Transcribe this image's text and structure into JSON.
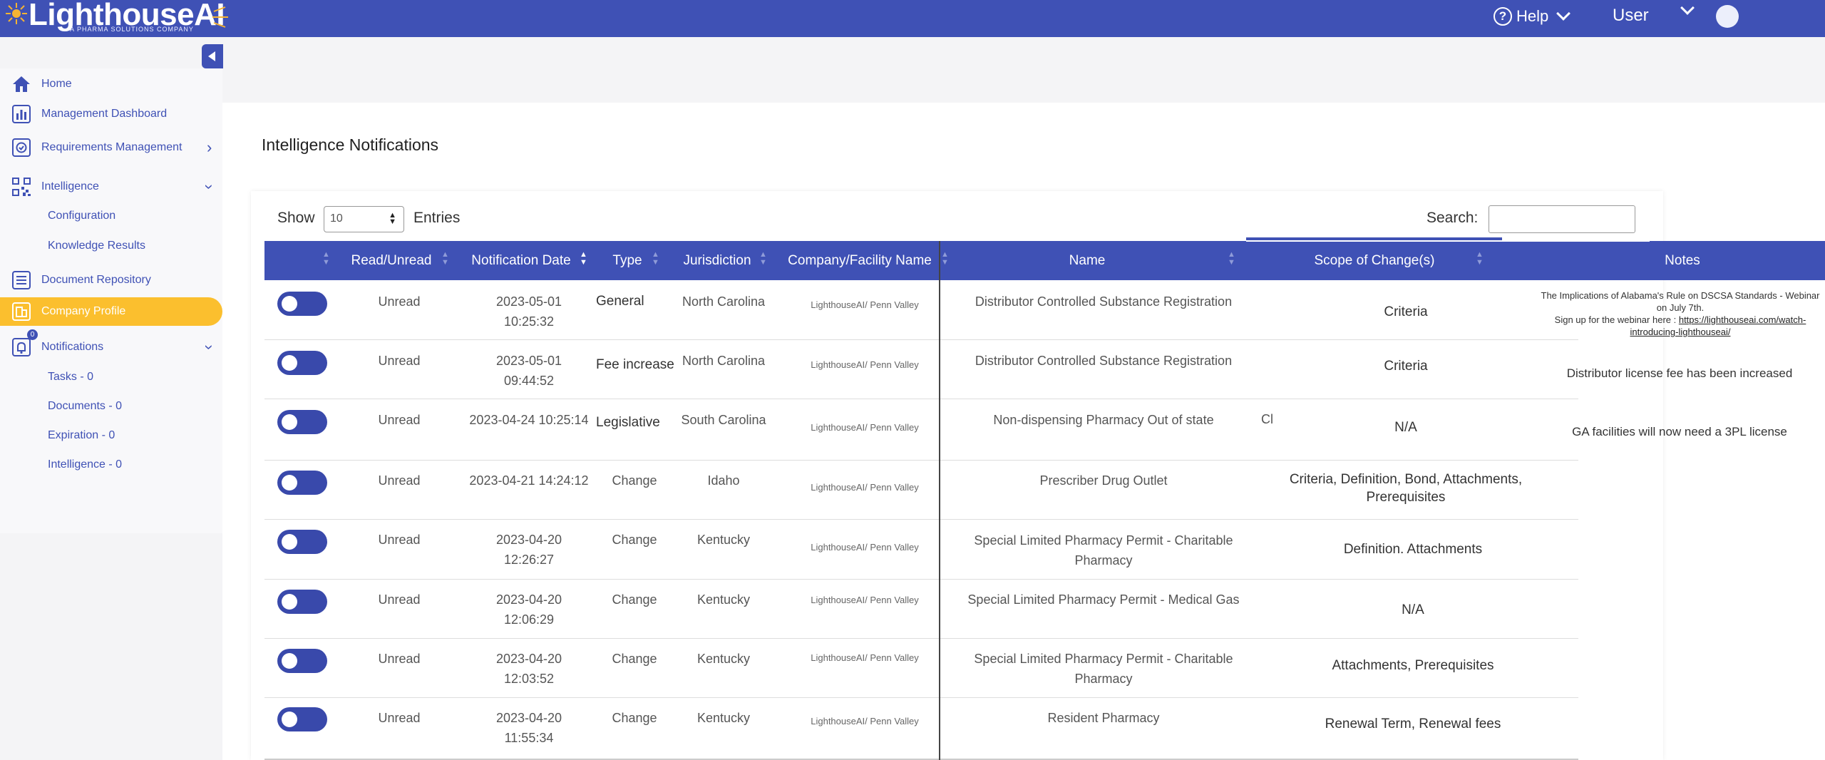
{
  "header": {
    "logo_text": "LighthouseAI",
    "logo_tagline": "A PHARMA SOLUTIONS COMPANY",
    "help_label": "Help",
    "user_label": "User"
  },
  "sidebar": {
    "items": [
      {
        "label": "Home",
        "icon": "home-icon"
      },
      {
        "label": "Management Dashboard",
        "icon": "bar-chart-icon"
      },
      {
        "label": "Requirements Management",
        "icon": "check-circle-icon"
      },
      {
        "label": "Intelligence",
        "icon": "qr-grid-icon"
      },
      {
        "label": "Configuration"
      },
      {
        "label": "Knowledge Results"
      },
      {
        "label": "Document Repository",
        "icon": "document-list-icon"
      },
      {
        "label": "Company Profile",
        "icon": "building-icon"
      },
      {
        "label": "Notifications",
        "icon": "bell-icon",
        "badge": "0"
      },
      {
        "label": "Tasks - 0"
      },
      {
        "label": "Documents - 0"
      },
      {
        "label": "Expiration - 0"
      },
      {
        "label": "Intelligence - 0"
      }
    ]
  },
  "page": {
    "title": "Intelligence Notifications",
    "show_label": "Show",
    "entries_value": "10",
    "entries_label": "Entries",
    "search_label": "Search:"
  },
  "table": {
    "columns": [
      "Read/Unread",
      "Notification Date",
      "Type",
      "Jurisdiction",
      "Company/Facility Name",
      "Name",
      "Scope of Change(s)",
      "Notes"
    ],
    "rows": [
      {
        "status": "Unread",
        "date": "2023-05-01",
        "time": "10:25:32",
        "type": "General",
        "jurisdiction": "North Carolina",
        "company": "LighthouseAI/ Penn Valley",
        "name": "Distributor Controlled Substance Registration",
        "scope": "Criteria"
      },
      {
        "status": "Unread",
        "date": "2023-05-01",
        "time": "09:44:52",
        "type": "Fee increase",
        "jurisdiction": "North Carolina",
        "company": "LighthouseAI/ Penn Valley",
        "name": "Distributor Controlled Substance Registration",
        "scope": "Criteria"
      },
      {
        "status": "Unread",
        "date": "2023-04-24 10:25:14",
        "time": "",
        "type": "Legislative",
        "jurisdiction": "South Carolina",
        "company": "LighthouseAI/ Penn Valley",
        "name": "Non-dispensing Pharmacy Out of state",
        "scope": "N/A"
      },
      {
        "status": "Unread",
        "date": "2023-04-21 14:24:12",
        "time": "",
        "type": "Change",
        "jurisdiction": "Idaho",
        "company": "LighthouseAI/ Penn Valley",
        "name": "Prescriber Drug Outlet",
        "scope": "Criteria, Definition, Bond, Attachments,",
        "scope2": "Prerequisites"
      },
      {
        "status": "Unread",
        "date": "2023-04-20",
        "time": "12:26:27",
        "type": "Change",
        "jurisdiction": "Kentucky",
        "company": "LighthouseAI/ Penn Valley",
        "name": "Special Limited Pharmacy Permit - Charitable",
        "name2": "Pharmacy",
        "scope": "Definition. Attachments"
      },
      {
        "status": "Unread",
        "date": "2023-04-20",
        "time": "12:06:29",
        "type": "Change",
        "jurisdiction": "Kentucky",
        "company": "LighthouseAI/ Penn Valley",
        "name": "Special Limited Pharmacy Permit - Medical Gas",
        "scope": "N/A"
      },
      {
        "status": "Unread",
        "date": "2023-04-20",
        "time": "12:03:52",
        "type": "Change",
        "jurisdiction": "Kentucky",
        "company": "LighthouseAI/ Penn Valley",
        "name": "Special Limited Pharmacy Permit - Charitable",
        "name2": "Pharmacy",
        "scope": "Attachments, Prerequisites"
      },
      {
        "status": "Unread",
        "date": "2023-04-20",
        "time": "11:55:34",
        "type": "Change",
        "jurisdiction": "Kentucky",
        "company": "LighthouseAI/ Penn Valley",
        "name": "Resident Pharmacy",
        "scope": "Renewal Term, Renewal fees"
      }
    ],
    "notes": {
      "n1_line1": "The Implications of Alabama's Rule on DSCSA Standards - Webinar",
      "n1_line2": "on July 7th.",
      "n1_line3": "Sign up for the webinar here : ",
      "n1_link1": "https://lighthouseai.com/watch-",
      "n1_link2": "introducing-lighthouseai/",
      "n2": "Distributor license fee has been increased",
      "n3": "GA facilities will now need a 3PL license"
    },
    "stray_text": "Cl"
  }
}
